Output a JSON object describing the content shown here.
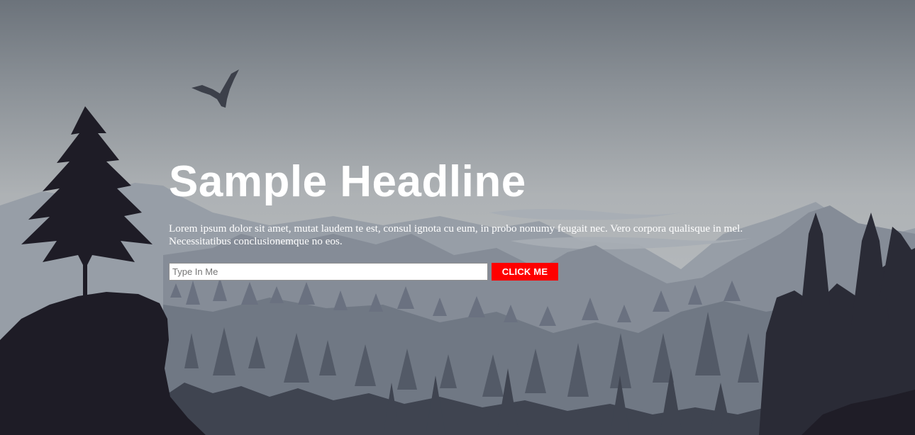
{
  "hero": {
    "headline": "Sample Headline",
    "body": "Lorem ipsum dolor sit amet, mutat laudem te est, consul ignota cu eum, in probo nonumy feugait nec. Vero corpora qualisque in mel. Necessitatibus conclusionemque no eos.",
    "input": {
      "value": "",
      "placeholder": "Type In Me"
    },
    "button_label": "CLICK ME"
  },
  "background": {
    "name": "misty-mountain-forest-landscape",
    "colors": {
      "sky_top": "#6f767e",
      "sky_mid": "#a8adb1",
      "fog": "#bdc1c4",
      "far_mountains": "#939aa3",
      "mid_mountains": "#7a828d",
      "near_trees": "#5a616c",
      "foreground": "#1e1c26"
    }
  },
  "accent": {
    "button": "#ff0000",
    "text": "#ffffff"
  }
}
